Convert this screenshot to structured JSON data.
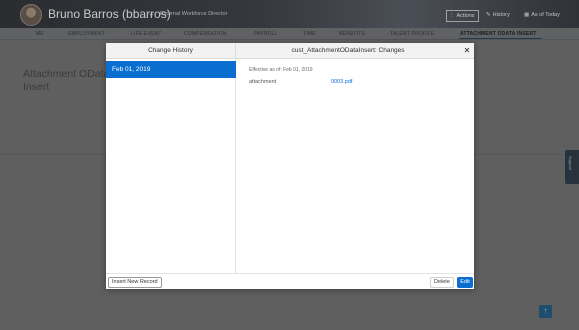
{
  "header": {
    "user_name": "Bruno Barros (bbarros)",
    "user_title": "External Workforce Director",
    "actions_label": "Actions",
    "history_label": "History",
    "as_of_label": "As of Today"
  },
  "tabs": [
    {
      "label": "ME"
    },
    {
      "label": "EMPLOYMENT"
    },
    {
      "label": "LIFE EVENT"
    },
    {
      "label": "COMPENSATION"
    },
    {
      "label": "PAYROLL"
    },
    {
      "label": "TIME"
    },
    {
      "label": "BENEFITS"
    },
    {
      "label": "TALENT PROFILE"
    },
    {
      "label": "ATTACHMENT ODATA INSERT",
      "active": true
    }
  ],
  "page": {
    "title": "Attachment OData Insert",
    "side_panel_label": "Support"
  },
  "modal": {
    "left_title": "Change History",
    "right_title": "cust_AttachmentODataInsert: Changes",
    "history_items": [
      {
        "label": "Feb 01, 2019",
        "selected": true
      }
    ],
    "effective_text": "Effective as of: Feb 01, 2019",
    "fields": [
      {
        "label": "attachment",
        "value": "0003.pdf"
      }
    ],
    "insert_button": "Insert New Record",
    "delete_button": "Delete",
    "edit_button": "Edit"
  },
  "icons": {
    "close": "close-icon",
    "actions": "info-icon",
    "history": "pencil-icon",
    "calendar": "calendar-icon",
    "scroll_top": "arrow-up-icon"
  },
  "colors": {
    "accent": "#0a6ed1",
    "overlay": "#5e5e5e"
  }
}
